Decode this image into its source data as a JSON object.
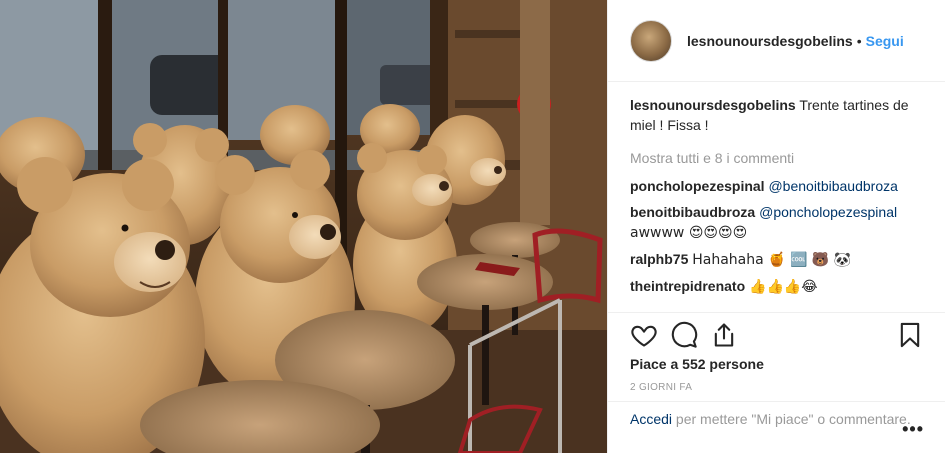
{
  "post": {
    "username": "lesnounoursdesgobelins",
    "separator": "•",
    "follow_label": "Segui"
  },
  "caption": {
    "username": "lesnounoursdesgobelins",
    "text": "Trente tartines de miel ! Fissa !"
  },
  "show_all_comments": "Mostra tutti e 8 i commenti",
  "comments": [
    {
      "user": "poncholopezespinal",
      "mention": "@benoitbibaudbroza",
      "text": ""
    },
    {
      "user": "benoitbibaudbroza",
      "mention": "@poncholopezespinal",
      "text": "awwww 😍😍😍😍"
    },
    {
      "user": "ralphb75",
      "mention": "",
      "text": "Hahahaha 🍯 🆒 🐻 🐼"
    },
    {
      "user": "theintrepidrenato",
      "mention": "",
      "text": "👍👍👍😂"
    }
  ],
  "icons": {
    "like": "heart-icon",
    "comment": "comment-icon",
    "share": "share-icon",
    "save": "bookmark-icon",
    "more": "more-options-icon"
  },
  "likes_text": "Piace a 552 persone",
  "time_ago": "2 giorni fa",
  "login_prompt": {
    "link": "Accedi",
    "text": " per mettere \"Mi piace\" o commentare.",
    "more_label": "•••"
  },
  "colors": {
    "link_blue": "#3897f0",
    "mention_dark_blue": "#003569",
    "muted_gray": "#999999",
    "border": "#efefef"
  }
}
